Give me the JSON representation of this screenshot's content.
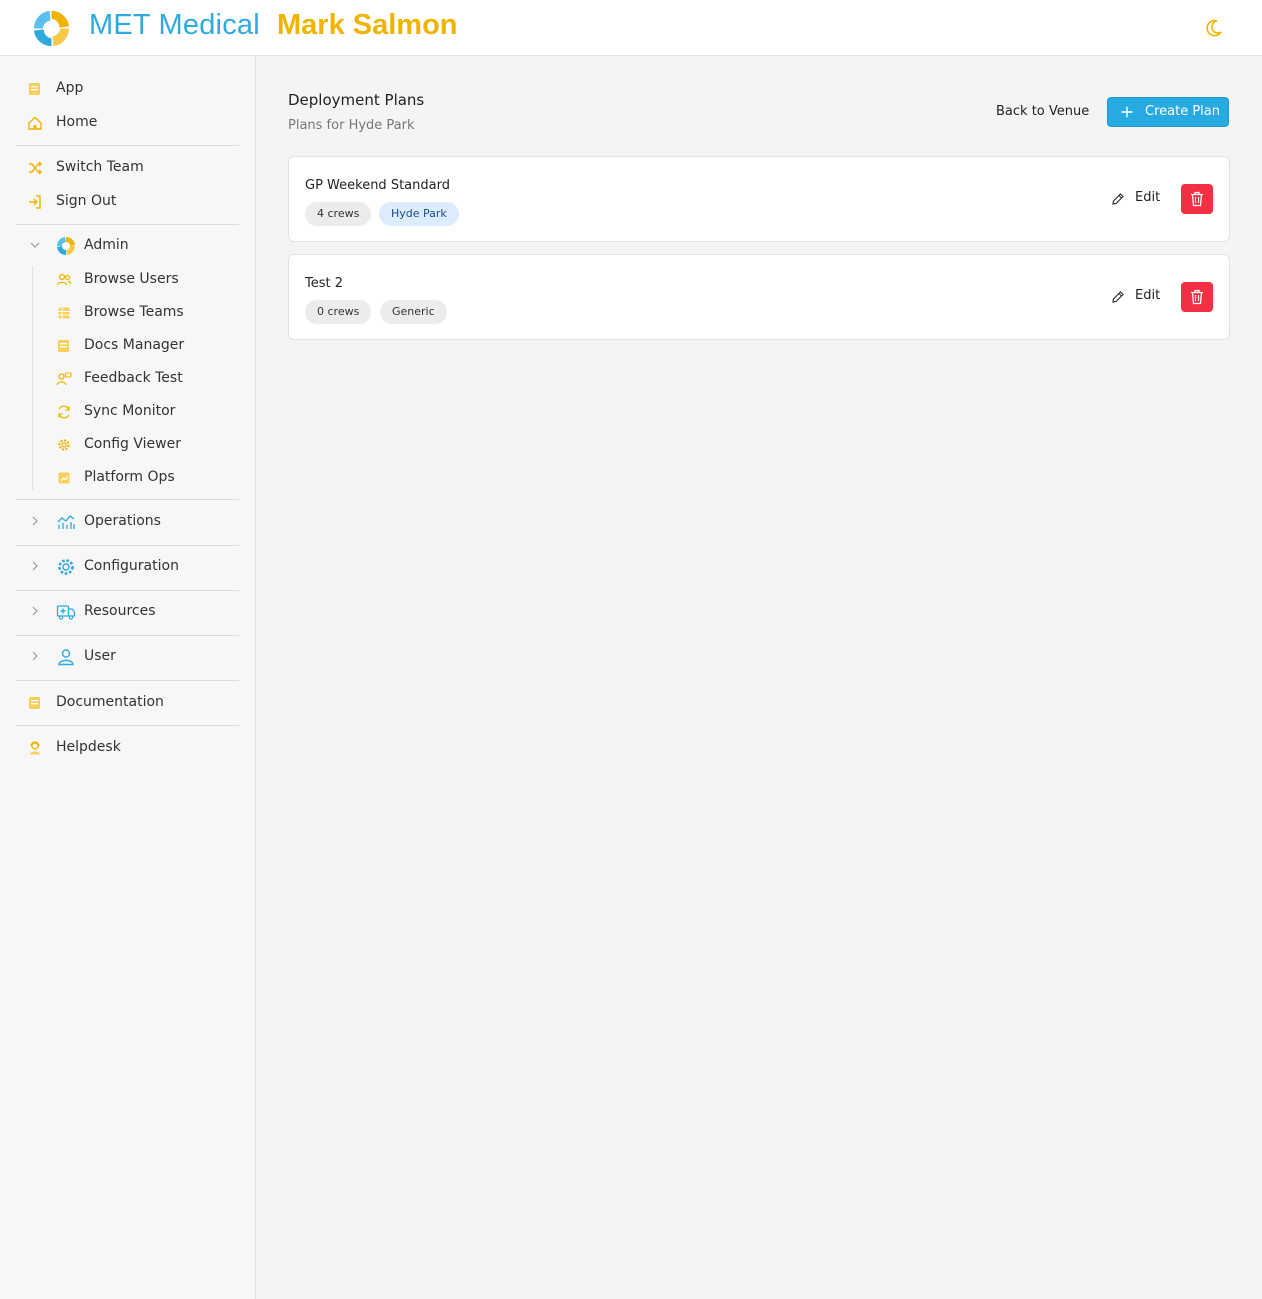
{
  "header": {
    "brand": "MET Medical",
    "user_name": "Mark Salmon",
    "theme_icon": "moon-icon"
  },
  "sidebar": {
    "top_items": [
      {
        "label": "App",
        "icon": "book-icon"
      },
      {
        "label": "Home",
        "icon": "home-icon"
      }
    ],
    "account_items": [
      {
        "label": "Switch Team",
        "icon": "shuffle-icon"
      },
      {
        "label": "Sign Out",
        "icon": "sign-out-icon"
      }
    ],
    "admin": {
      "label": "Admin",
      "expanded": true,
      "items": [
        {
          "label": "Browse Users",
          "icon": "users-icon"
        },
        {
          "label": "Browse Teams",
          "icon": "table-icon"
        },
        {
          "label": "Docs Manager",
          "icon": "book-icon"
        },
        {
          "label": "Feedback Test",
          "icon": "user-comment-icon"
        },
        {
          "label": "Sync Monitor",
          "icon": "sync-icon"
        },
        {
          "label": "Config Viewer",
          "icon": "gear-icon"
        },
        {
          "label": "Platform Ops",
          "icon": "chart-icon"
        }
      ]
    },
    "groups": [
      {
        "label": "Operations",
        "icon": "chart-line-icon"
      },
      {
        "label": "Configuration",
        "icon": "gear-icon"
      },
      {
        "label": "Resources",
        "icon": "ambulance-icon"
      },
      {
        "label": "User",
        "icon": "user-icon"
      }
    ],
    "bottom_items": [
      {
        "label": "Documentation",
        "icon": "book-icon"
      },
      {
        "label": "Helpdesk",
        "icon": "support-agent-icon"
      }
    ]
  },
  "main": {
    "title": "Deployment Plans",
    "subtitle": "Plans for Hyde Park",
    "back_label": "Back to Venue",
    "create_label": "Create Plan",
    "plans": [
      {
        "name": "GP Weekend Standard",
        "crews": "4 crews",
        "venue": "Hyde Park",
        "venue_style": "blue",
        "edit_label": "Edit"
      },
      {
        "name": "Test 2",
        "crews": "0 crews",
        "venue": "Generic",
        "venue_style": "gray",
        "edit_label": "Edit"
      }
    ]
  },
  "colors": {
    "brand_blue": "#2eaadf",
    "brand_gold": "#f0b400",
    "primary_button": "#27a9e1",
    "danger": "#f23041"
  }
}
